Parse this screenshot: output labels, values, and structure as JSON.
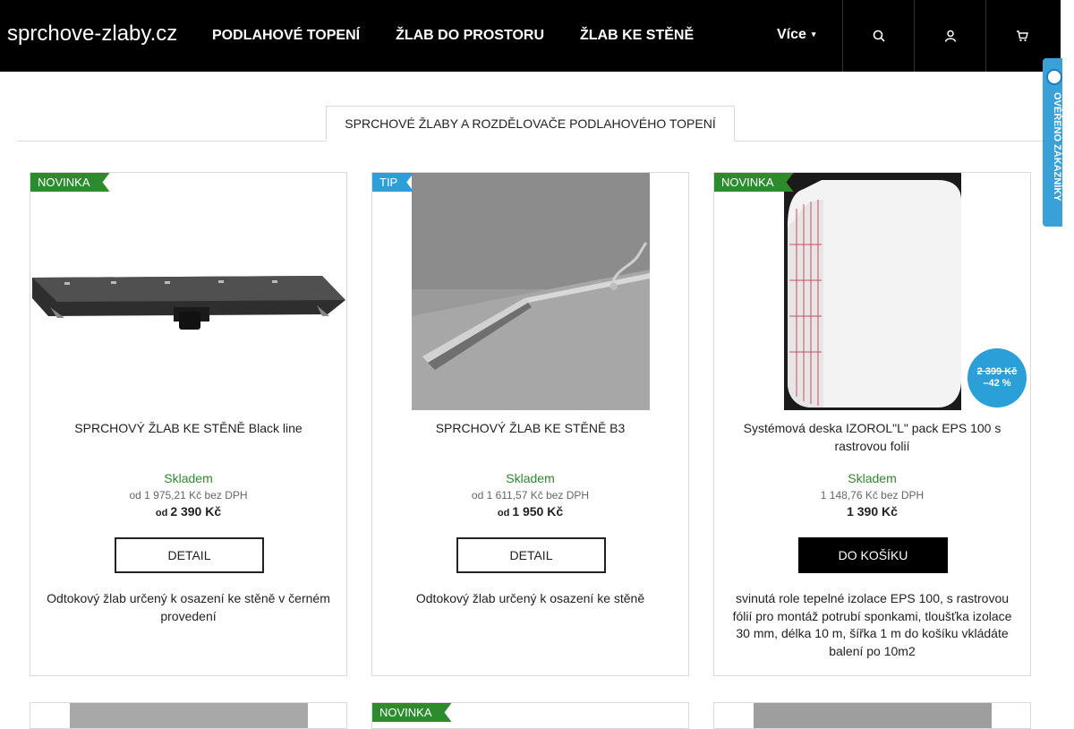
{
  "header": {
    "logo": "sprchove-zlaby.cz",
    "nav": [
      "PODLAHOVÉ TOPENÍ",
      "ŽLAB DO PROSTORU",
      "ŽLAB KE STĚNĚ"
    ],
    "more": "Více"
  },
  "side_badge": {
    "text": "OVĚŘENO ZÁKAZNÍKY"
  },
  "tab": {
    "label": "SPRCHOVÉ ŽLABY A ROZDĚLOVAČE PODLAHOVÉHO TOPENÍ"
  },
  "products": [
    {
      "flag": "NOVINKA",
      "title": "SPRCHOVÝ ŽLAB KE STĚNĚ Black line",
      "stock": "Skladem",
      "price_net": "od 1 975,21 Kč bez DPH",
      "price_prefix": "od",
      "price": "2 390 Kč",
      "button": "DETAIL",
      "description": "Odtokový žlab určený k osazení ke stěně v černém provedení"
    },
    {
      "flag": "TIP",
      "title": "SPRCHOVÝ ŽLAB KE STĚNĚ B3",
      "stock": "Skladem",
      "price_net": "od 1 611,57 Kč bez DPH",
      "price_prefix": "od",
      "price": "1 950 Kč",
      "button": "DETAIL",
      "description": "Odtokový žlab určený k osazení ke stěně"
    },
    {
      "flag": "NOVINKA",
      "title": "Systémová deska IZOROL\"L\" pack EPS 100 s rastrovou folií",
      "stock": "Skladem",
      "price_net": "1 148,76 Kč bez DPH",
      "price_prefix": "",
      "price": "1 390 Kč",
      "button": "DO KOŠÍKU",
      "description": "svinutá role tepelné izolace EPS 100, s rastrovou fólií pro montáž potrubí sponkami, tloušťka izolace 30 mm, délka 10 m, šířka 1 m do košíku vkládáte balení po 10m2",
      "discount_old": "2 399 Kč",
      "discount_pct": "–42 %"
    }
  ],
  "next_row": {
    "flag": "NOVINKA"
  },
  "colors": {
    "header_bg": "#000000",
    "flag_new": "#2d8b2d",
    "flag_tip": "#2b9fd8",
    "stock": "#2d8b2d",
    "discount": "#2b9fd8"
  }
}
